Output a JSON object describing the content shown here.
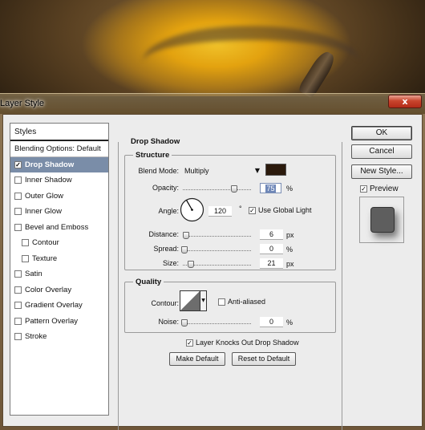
{
  "dialog": {
    "title": "Layer Style",
    "close_glyph": "x"
  },
  "styles_panel": {
    "header": "Styles",
    "items": [
      {
        "label": "Blending Options: Default",
        "checkbox": false,
        "checked": false,
        "indent": false,
        "selected": false
      },
      {
        "label": "Drop Shadow",
        "checkbox": true,
        "checked": true,
        "indent": false,
        "selected": true
      },
      {
        "label": "Inner Shadow",
        "checkbox": true,
        "checked": false,
        "indent": false,
        "selected": false
      },
      {
        "label": "Outer Glow",
        "checkbox": true,
        "checked": false,
        "indent": false,
        "selected": false
      },
      {
        "label": "Inner Glow",
        "checkbox": true,
        "checked": false,
        "indent": false,
        "selected": false
      },
      {
        "label": "Bevel and Emboss",
        "checkbox": true,
        "checked": false,
        "indent": false,
        "selected": false
      },
      {
        "label": "Contour",
        "checkbox": true,
        "checked": false,
        "indent": true,
        "selected": false
      },
      {
        "label": "Texture",
        "checkbox": true,
        "checked": false,
        "indent": true,
        "selected": false
      },
      {
        "label": "Satin",
        "checkbox": true,
        "checked": false,
        "indent": false,
        "selected": false
      },
      {
        "label": "Color Overlay",
        "checkbox": true,
        "checked": false,
        "indent": false,
        "selected": false
      },
      {
        "label": "Gradient Overlay",
        "checkbox": true,
        "checked": false,
        "indent": false,
        "selected": false
      },
      {
        "label": "Pattern Overlay",
        "checkbox": true,
        "checked": false,
        "indent": false,
        "selected": false
      },
      {
        "label": "Stroke",
        "checkbox": true,
        "checked": false,
        "indent": false,
        "selected": false
      }
    ]
  },
  "drop_shadow": {
    "title": "Drop Shadow",
    "structure": {
      "title": "Structure",
      "blend_mode_label": "Blend Mode:",
      "blend_mode_value": "Multiply",
      "shadow_color": "#2b1a0c",
      "opacity_label": "Opacity:",
      "opacity_value": "75",
      "opacity_unit": "%",
      "opacity_level": 0.75,
      "angle_label": "Angle:",
      "angle_value": "120",
      "angle_unit": "°",
      "use_global_light_label": "Use Global Light",
      "use_global_light_checked": true,
      "distance_label": "Distance:",
      "distance_value": "6",
      "distance_unit": "px",
      "spread_label": "Spread:",
      "spread_value": "0",
      "spread_unit": "%",
      "size_label": "Size:",
      "size_value": "21",
      "size_unit": "px"
    },
    "quality": {
      "title": "Quality",
      "contour_label": "Contour:",
      "anti_aliased_label": "Anti-aliased",
      "anti_aliased_checked": false,
      "noise_label": "Noise:",
      "noise_value": "0",
      "noise_unit": "%"
    },
    "knocks_out_label": "Layer Knocks Out Drop Shadow",
    "knocks_out_checked": true,
    "make_default_label": "Make Default",
    "reset_default_label": "Reset to Default"
  },
  "buttons": {
    "ok": "OK",
    "cancel": "Cancel",
    "new_style": "New Style...",
    "preview_label": "Preview",
    "preview_checked": true
  },
  "colors": {
    "selection": "#7a8da8",
    "dialog_bg": "#ececec",
    "close_button": "#c9452d"
  }
}
